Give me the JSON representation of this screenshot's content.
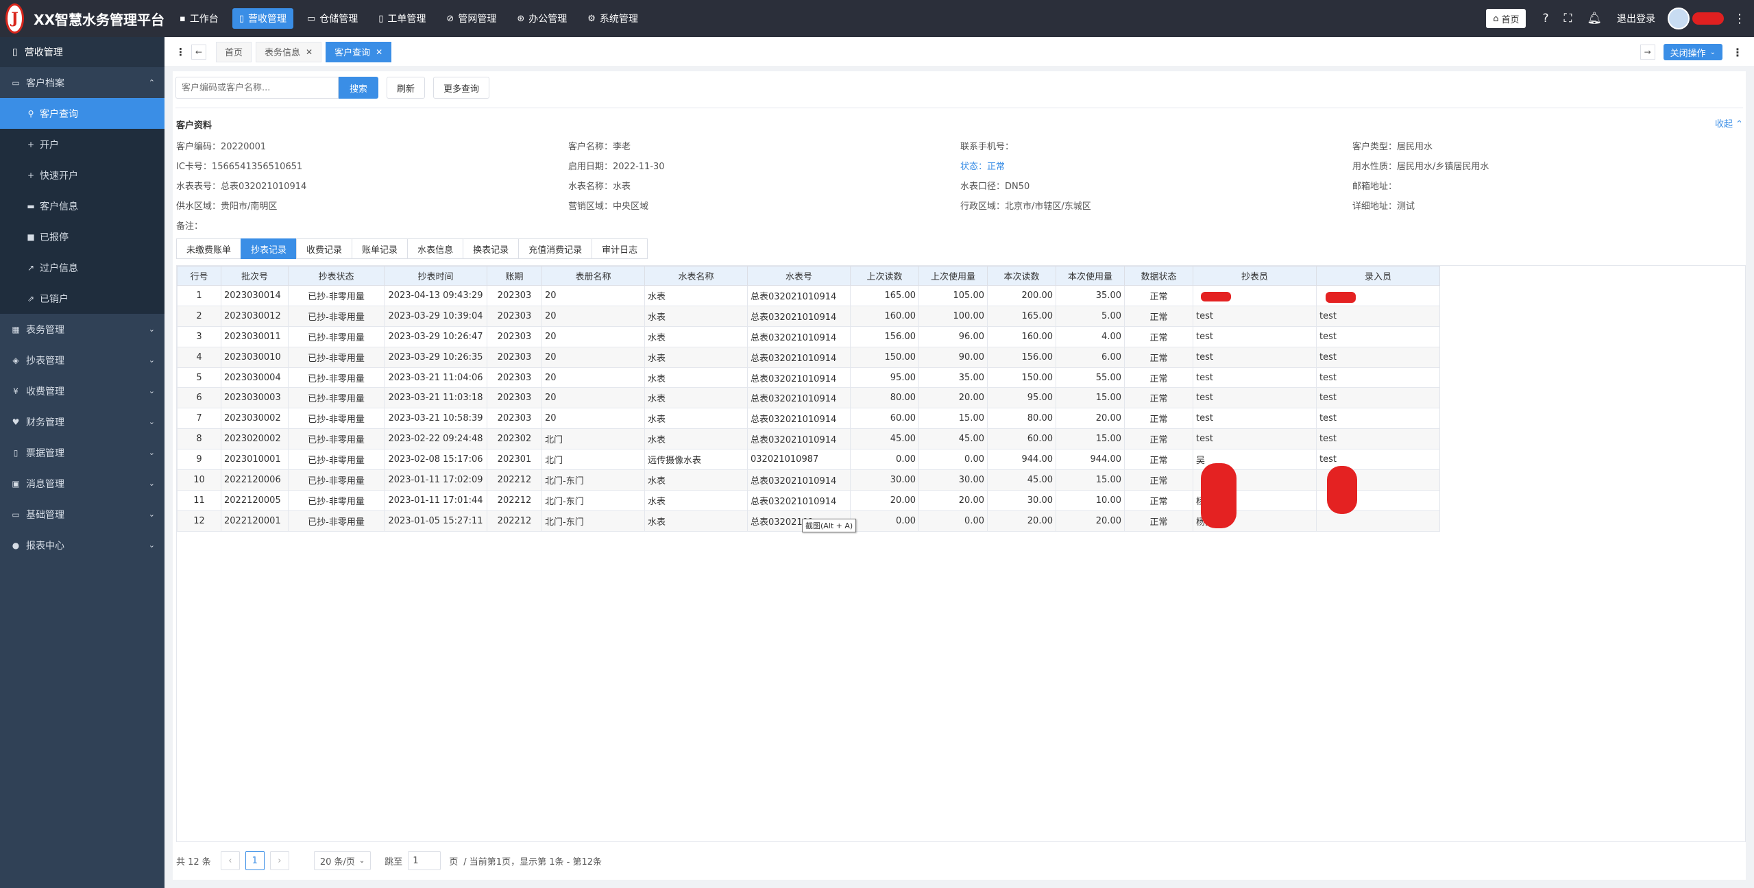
{
  "app": {
    "title": "XX智慧水务管理平台",
    "logo_text": "J"
  },
  "topnav": [
    {
      "label": "工作台",
      "icon": "dashboard-icon",
      "glyph": "▪"
    },
    {
      "label": "营收管理",
      "icon": "revenue-icon",
      "glyph": "▯",
      "active": true
    },
    {
      "label": "仓储管理",
      "icon": "warehouse-icon",
      "glyph": "▭"
    },
    {
      "label": "工单管理",
      "icon": "work-order-icon",
      "glyph": "▯"
    },
    {
      "label": "管网管理",
      "icon": "pipe-network-icon",
      "glyph": "⊘"
    },
    {
      "label": "办公管理",
      "icon": "office-icon",
      "glyph": "⊛"
    },
    {
      "label": "系统管理",
      "icon": "settings-icon",
      "glyph": "⚙"
    }
  ],
  "topright": {
    "home_label": "首页",
    "logout_label": "退出登录"
  },
  "sidebar": {
    "header": "营收管理",
    "groups": [
      {
        "label": "客户档案",
        "icon": "customer-archive-icon",
        "glyph": "▭",
        "expanded": true,
        "children": [
          {
            "label": "客户查询",
            "icon": "search-icon",
            "glyph": "⚲",
            "active": true
          },
          {
            "label": "开户",
            "icon": "plus-icon",
            "glyph": "+"
          },
          {
            "label": "快速开户",
            "icon": "plus-icon",
            "glyph": "+"
          },
          {
            "label": "客户信息",
            "icon": "customer-info-icon",
            "glyph": "▬"
          },
          {
            "label": "已报停",
            "icon": "stopped-icon",
            "glyph": "■"
          },
          {
            "label": "过户信息",
            "icon": "transfer-icon",
            "glyph": "↗"
          },
          {
            "label": "已销户",
            "icon": "closed-account-icon",
            "glyph": "⇗"
          }
        ]
      },
      {
        "label": "表务管理",
        "icon": "meter-service-icon",
        "glyph": "▦"
      },
      {
        "label": "抄表管理",
        "icon": "meter-reading-icon",
        "glyph": "◈"
      },
      {
        "label": "收费管理",
        "icon": "yen-icon",
        "glyph": "¥"
      },
      {
        "label": "财务管理",
        "icon": "finance-icon",
        "glyph": "♥"
      },
      {
        "label": "票据管理",
        "icon": "invoice-icon",
        "glyph": "▯"
      },
      {
        "label": "消息管理",
        "icon": "message-icon",
        "glyph": "▣"
      },
      {
        "label": "基础管理",
        "icon": "basic-icon",
        "glyph": "▭"
      },
      {
        "label": "报表中心",
        "icon": "report-icon",
        "glyph": "●"
      }
    ]
  },
  "pagetabs": [
    {
      "label": "首页",
      "closable": false
    },
    {
      "label": "表务信息",
      "closable": true
    },
    {
      "label": "客户查询",
      "closable": true,
      "active": true
    }
  ],
  "tabsbar": {
    "close_ops_label": "关闭操作"
  },
  "search": {
    "placeholder": "客户编码或客户名称...",
    "search_label": "搜索",
    "refresh_label": "刷新",
    "more_label": "更多查询"
  },
  "info": {
    "title": "客户资料",
    "collapse_label": "收起",
    "rows": [
      [
        {
          "label": "客户编码：",
          "value": "20220001"
        },
        {
          "label": "客户名称：",
          "value": "李老"
        },
        {
          "label": "联系手机号：",
          "value": ""
        },
        {
          "label": "客户类型：",
          "value": "居民用水"
        }
      ],
      [
        {
          "label": "IC卡号：",
          "value": "1566541356510651"
        },
        {
          "label": "启用日期：",
          "value": "2022-11-30"
        },
        {
          "label": "状态：",
          "value": "正常",
          "highlight": true
        },
        {
          "label": "用水性质：",
          "value": "居民用水/乡镇居民用水"
        }
      ],
      [
        {
          "label": "水表表号：",
          "value": "总表032021010914"
        },
        {
          "label": "水表名称：",
          "value": "水表"
        },
        {
          "label": "水表口径：",
          "value": "DN50"
        },
        {
          "label": "邮箱地址：",
          "value": ""
        }
      ],
      [
        {
          "label": "供水区域：",
          "value": "贵阳市/南明区"
        },
        {
          "label": "营销区域：",
          "value": "中央区域"
        },
        {
          "label": "行政区域：",
          "value": "北京市/市辖区/东城区"
        },
        {
          "label": "详细地址：",
          "value": "测试"
        }
      ],
      [
        {
          "label": "备注：",
          "value": ""
        }
      ]
    ]
  },
  "subtabs": [
    {
      "label": "未缴费账单"
    },
    {
      "label": "抄表记录",
      "active": true
    },
    {
      "label": "收费记录"
    },
    {
      "label": "账单记录"
    },
    {
      "label": "水表信息"
    },
    {
      "label": "换表记录"
    },
    {
      "label": "充值消费记录"
    },
    {
      "label": "审计日志"
    }
  ],
  "table": {
    "columns": [
      "行号",
      "批次号",
      "抄表状态",
      "抄表时间",
      "账期",
      "表册名称",
      "水表名称",
      "水表号",
      "上次读数",
      "上次使用量",
      "本次读数",
      "本次使用量",
      "数据状态",
      "抄表员",
      "录入员"
    ],
    "rows": [
      [
        "1",
        "2023030014",
        "已抄-非零用量",
        "2023-04-13 09:43:29",
        "202303",
        "20",
        "水表",
        "总表032021010914",
        "165.00",
        "105.00",
        "200.00",
        "35.00",
        "正常",
        "",
        ""
      ],
      [
        "2",
        "2023030012",
        "已抄-非零用量",
        "2023-03-29 10:39:04",
        "202303",
        "20",
        "水表",
        "总表032021010914",
        "160.00",
        "100.00",
        "165.00",
        "5.00",
        "正常",
        "test",
        "test"
      ],
      [
        "3",
        "2023030011",
        "已抄-非零用量",
        "2023-03-29 10:26:47",
        "202303",
        "20",
        "水表",
        "总表032021010914",
        "156.00",
        "96.00",
        "160.00",
        "4.00",
        "正常",
        "test",
        "test"
      ],
      [
        "4",
        "2023030010",
        "已抄-非零用量",
        "2023-03-29 10:26:35",
        "202303",
        "20",
        "水表",
        "总表032021010914",
        "150.00",
        "90.00",
        "156.00",
        "6.00",
        "正常",
        "test",
        "test"
      ],
      [
        "5",
        "2023030004",
        "已抄-非零用量",
        "2023-03-21 11:04:06",
        "202303",
        "20",
        "水表",
        "总表032021010914",
        "95.00",
        "35.00",
        "150.00",
        "55.00",
        "正常",
        "test",
        "test"
      ],
      [
        "6",
        "2023030003",
        "已抄-非零用量",
        "2023-03-21 11:03:18",
        "202303",
        "20",
        "水表",
        "总表032021010914",
        "80.00",
        "20.00",
        "95.00",
        "15.00",
        "正常",
        "test",
        "test"
      ],
      [
        "7",
        "2023030002",
        "已抄-非零用量",
        "2023-03-21 10:58:39",
        "202303",
        "20",
        "水表",
        "总表032021010914",
        "60.00",
        "15.00",
        "80.00",
        "20.00",
        "正常",
        "test",
        "test"
      ],
      [
        "8",
        "2023020002",
        "已抄-非零用量",
        "2023-02-22 09:24:48",
        "202302",
        "北门",
        "水表",
        "总表032021010914",
        "45.00",
        "45.00",
        "60.00",
        "15.00",
        "正常",
        "test",
        "test"
      ],
      [
        "9",
        "2023010001",
        "已抄-非零用量",
        "2023-02-08 15:17:06",
        "202301",
        "北门",
        "远传摄像水表",
        "032021010987",
        "0.00",
        "0.00",
        "944.00",
        "944.00",
        "正常",
        "吴",
        "test"
      ],
      [
        "10",
        "2022120006",
        "已抄-非零用量",
        "2023-01-11 17:02:09",
        "202212",
        "北门-东门",
        "水表",
        "总表032021010914",
        "30.00",
        "30.00",
        "45.00",
        "15.00",
        "正常",
        "",
        ""
      ],
      [
        "11",
        "2022120005",
        "已抄-非零用量",
        "2023-01-11 17:01:44",
        "202212",
        "北门-东门",
        "水表",
        "总表032021010914",
        "20.00",
        "20.00",
        "30.00",
        "10.00",
        "正常",
        "杨",
        ""
      ],
      [
        "12",
        "2022120001",
        "已抄-非零用量",
        "2023-01-05 15:27:11",
        "202212",
        "北门-东门",
        "水表",
        "总表03202101",
        "0.00",
        "0.00",
        "20.00",
        "20.00",
        "正常",
        "杨晶晶",
        ""
      ]
    ]
  },
  "tooltip": "截图(Alt + A)",
  "pager": {
    "total_label": "共 12 条",
    "current_page": "1",
    "page_size_label": "20 条/页",
    "jump_label": "跳至",
    "jump_value": "1",
    "page_unit": "页",
    "summary": "/  当前第1页，显示第 1条 - 第12条"
  },
  "colors": {
    "primary": "#3a8ee6",
    "topbar": "#2b2f3a",
    "sidebar": "#304156",
    "redaction": "#e42222"
  }
}
